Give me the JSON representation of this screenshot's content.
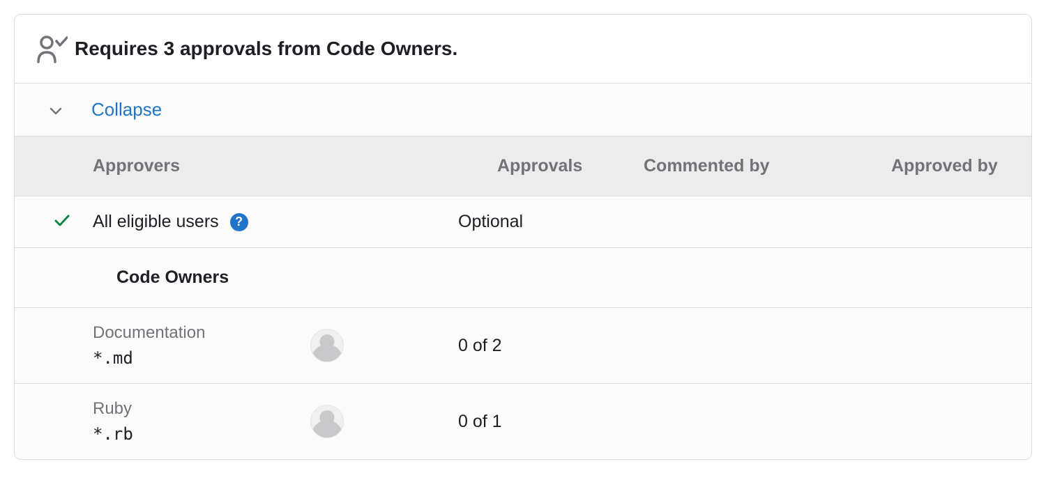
{
  "header": {
    "title": "Requires 3 approvals from Code Owners."
  },
  "collapse": {
    "label": "Collapse"
  },
  "columns": {
    "approvers": "Approvers",
    "approvals": "Approvals",
    "commented": "Commented by",
    "approved": "Approved by"
  },
  "eligible": {
    "label": "All eligible users",
    "help": "?",
    "approvals": "Optional"
  },
  "section": {
    "title": "Code Owners"
  },
  "codeowners": [
    {
      "name": "Documentation",
      "pattern": "*.md",
      "approvals": "0 of 2"
    },
    {
      "name": "Ruby",
      "pattern": "*.rb",
      "approvals": "0 of 1"
    }
  ]
}
